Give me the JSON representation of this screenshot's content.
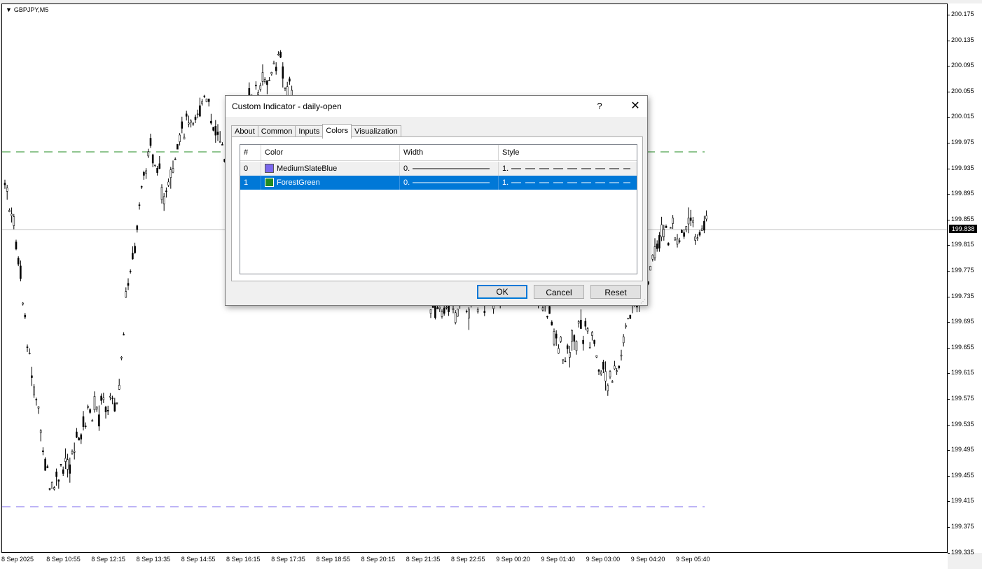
{
  "chart": {
    "symbol": "GBPJPY,M5",
    "current_price": "199.838",
    "price_ticks": [
      "200.175",
      "200.135",
      "200.095",
      "200.055",
      "200.015",
      "199.975",
      "199.935",
      "199.895",
      "199.855",
      "199.815",
      "199.775",
      "199.735",
      "199.695",
      "199.655",
      "199.615",
      "199.575",
      "199.535",
      "199.495",
      "199.455",
      "199.415",
      "199.375",
      "199.335"
    ],
    "time_ticks": [
      "8 Sep 2025",
      "8 Sep 10:55",
      "8 Sep 12:15",
      "8 Sep 13:35",
      "8 Sep 14:55",
      "8 Sep 16:15",
      "8 Sep 17:35",
      "8 Sep 18:55",
      "8 Sep 20:15",
      "8 Sep 21:35",
      "8 Sep 22:55",
      "9 Sep 00:20",
      "9 Sep 01:40",
      "9 Sep 03:00",
      "9 Sep 04:20",
      "9 Sep 05:40"
    ],
    "colors": {
      "candles": "#000000",
      "green_level": "#228B22",
      "blue_level": "#7B68EE",
      "current_line": "#c0c0c0"
    }
  },
  "dialog": {
    "title": "Custom Indicator - daily-open",
    "help_label": "?",
    "close_label": "✕",
    "tabs": [
      {
        "label": "About",
        "active": false
      },
      {
        "label": "Common",
        "active": false
      },
      {
        "label": "Inputs",
        "active": false
      },
      {
        "label": "Colors",
        "active": true
      },
      {
        "label": "Visualization",
        "active": false
      }
    ],
    "grid": {
      "headers": [
        "#",
        "Color",
        "Width",
        "Style"
      ],
      "rows": [
        {
          "index": "0",
          "color_name": "MediumSlateBlue",
          "swatch": "#7B68EE",
          "width": "0.",
          "style": "1.",
          "selected": false
        },
        {
          "index": "1",
          "color_name": "ForestGreen",
          "swatch": "#228B22",
          "width": "0.",
          "style": "1.",
          "selected": true
        }
      ]
    },
    "buttons": {
      "ok": "OK",
      "cancel": "Cancel",
      "reset": "Reset"
    }
  }
}
